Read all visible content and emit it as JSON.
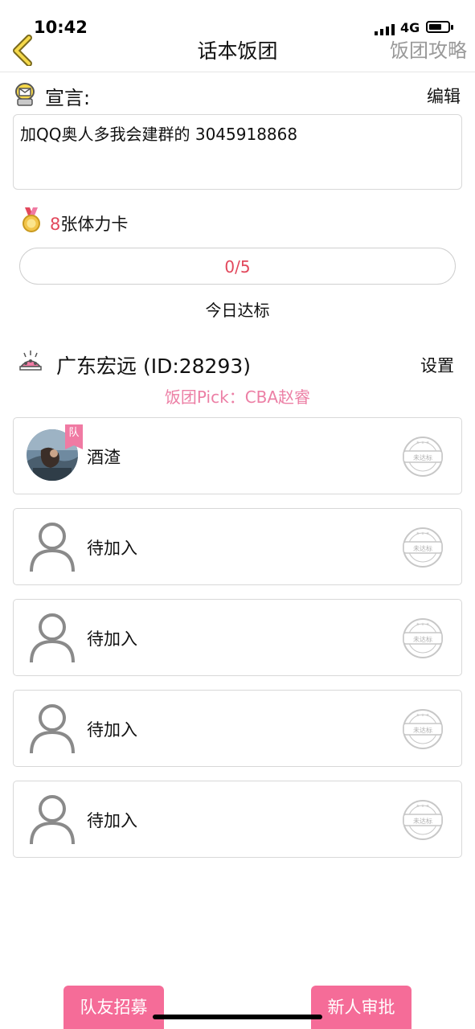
{
  "status_bar": {
    "time": "10:42",
    "network": "4G"
  },
  "nav": {
    "title": "话本饭团",
    "right_action": "饭团攻略"
  },
  "declaration": {
    "label": "宣言:",
    "edit": "编辑",
    "text": "加QQ奥人多我会建群的 3045918868"
  },
  "stamina": {
    "count": "8",
    "unit": "张体力卡"
  },
  "progress": {
    "text": "0/5",
    "value": 0,
    "max": 5,
    "caption": "今日达标"
  },
  "group": {
    "name": "广东宏远 (ID:28293)",
    "settings": "设置",
    "pick": "饭团Pick：CBA赵睿"
  },
  "members": [
    {
      "name": "酒渣",
      "tag": "队",
      "stamp": "未达标"
    },
    {
      "name": "待加入",
      "stamp": "未达标"
    },
    {
      "name": "待加入",
      "stamp": "未达标"
    },
    {
      "name": "待加入",
      "stamp": "未达标"
    },
    {
      "name": "待加入",
      "stamp": "未达标"
    }
  ],
  "bottom": {
    "recruit": "队友招募",
    "approve": "新人审批"
  },
  "colors": {
    "accent_pink": "#f56c98",
    "number_red": "#e2485c",
    "pick_pink": "#ec7fa5"
  }
}
